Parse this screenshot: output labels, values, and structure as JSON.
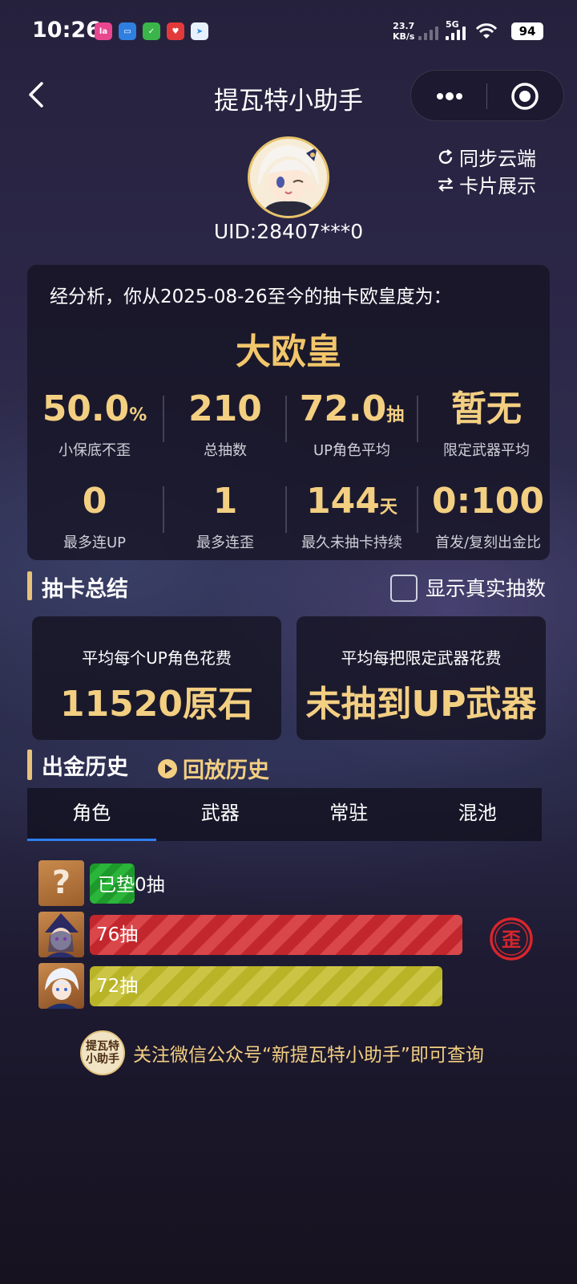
{
  "status_bar": {
    "time": "10:26",
    "speed_value": "23.7",
    "speed_unit": "KB/s",
    "network": "5G",
    "battery": "94",
    "app_icons": [
      "lala-app-icon",
      "chat-app-icon",
      "check-app-icon",
      "heart-app-icon",
      "paper-plane-app-icon"
    ]
  },
  "nav": {
    "title": "提瓦特小助手"
  },
  "profile": {
    "uid": "UID:28407***0",
    "sync_label": "同步云端",
    "card_label": "卡片展示"
  },
  "analysis": {
    "summary_line": "经分析，你从2025-08-26至今的抽卡欧皇度为：",
    "rank": "大欧皇",
    "stats": [
      {
        "value": "50.0",
        "unit": "%",
        "label": "小保底不歪"
      },
      {
        "value": "210",
        "unit": "",
        "label": "总抽数"
      },
      {
        "value": "72.0",
        "unit": "抽",
        "label": "UP角色平均"
      },
      {
        "value": "暂无",
        "unit": "",
        "label": "限定武器平均"
      },
      {
        "value": "0",
        "unit": "",
        "label": "最多连UP"
      },
      {
        "value": "1",
        "unit": "",
        "label": "最多连歪"
      },
      {
        "value": "144",
        "unit": "天",
        "label": "最久未抽卡持续"
      },
      {
        "value": "0:100",
        "unit": "",
        "label": "首发/复刻出金比"
      }
    ]
  },
  "summary": {
    "title": "抽卡总结",
    "toggle_label": "显示真实抽数",
    "toggle_checked": false,
    "cards": [
      {
        "title": "平均每个UP角色花费",
        "value": "11520原石"
      },
      {
        "title": "平均每把限定武器花费",
        "value": "未抽到UP武器"
      }
    ]
  },
  "history": {
    "title": "出金历史",
    "replay_label": "回放历史",
    "tabs": [
      "角色",
      "武器",
      "常驻",
      "混池"
    ],
    "active_tab": 0,
    "pending": {
      "badge": "已垫",
      "count": "0抽"
    },
    "entries": [
      {
        "label": "76抽",
        "pulls": 76,
        "color": "#d03a3f",
        "off_banner": true,
        "off_banner_mark": "歪"
      },
      {
        "label": "72抽",
        "pulls": 72,
        "color": "#c4be3a",
        "off_banner": false
      }
    ]
  },
  "footer": {
    "logo_text": "提瓦特小助手",
    "text": "关注微信公众号“新提瓦特小助手”即可查询"
  }
}
